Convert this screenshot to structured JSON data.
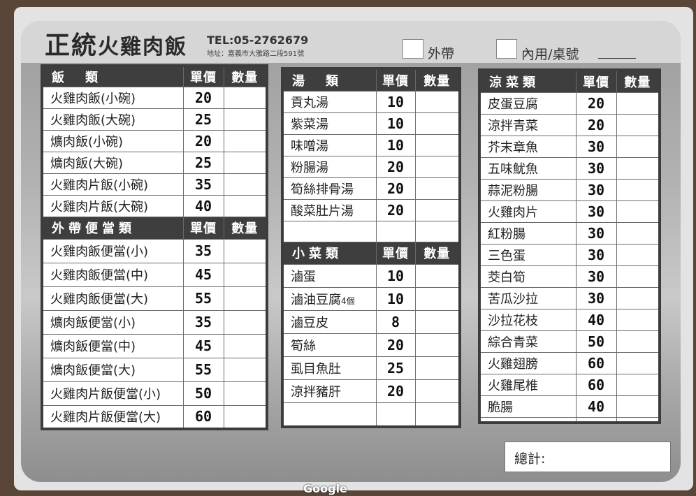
{
  "header": {
    "title_a": "正統",
    "title_b": "火雞肉飯",
    "tel": "TEL:05-2762679",
    "address": "地址：嘉義市大雅路二段591號",
    "takeout_label": "外帶",
    "dinein_label": "內用/桌號"
  },
  "col_price": "單價",
  "col_qty": "數量",
  "sections": {
    "rice": {
      "title": "飯　類",
      "items": [
        {
          "name": "火雞肉飯(小碗)",
          "price": "20"
        },
        {
          "name": "火雞肉飯(大碗)",
          "price": "25"
        },
        {
          "name": "爌肉飯(小碗)",
          "price": "20"
        },
        {
          "name": "爌肉飯(大碗)",
          "price": "25"
        },
        {
          "name": "火雞肉片飯(小碗)",
          "price": "35"
        },
        {
          "name": "火雞肉片飯(大碗)",
          "price": "40"
        }
      ]
    },
    "bento": {
      "title": "外帶便當類",
      "items": [
        {
          "name": "火雞肉飯便當(小)",
          "price": "35"
        },
        {
          "name": "火雞肉飯便當(中)",
          "price": "45"
        },
        {
          "name": "火雞肉飯便當(大)",
          "price": "55"
        },
        {
          "name": "爌肉飯便當(小)",
          "price": "35"
        },
        {
          "name": "爌肉飯便當(中)",
          "price": "45"
        },
        {
          "name": "爌肉飯便當(大)",
          "price": "55"
        },
        {
          "name": "火雞肉片飯便當(小)",
          "price": "50"
        },
        {
          "name": "火雞肉片飯便當(大)",
          "price": "60"
        }
      ]
    },
    "soup": {
      "title": "湯　類",
      "items": [
        {
          "name": "貢丸湯",
          "price": "10"
        },
        {
          "name": "紫菜湯",
          "price": "10"
        },
        {
          "name": "味噌湯",
          "price": "10"
        },
        {
          "name": "粉腸湯",
          "price": "20"
        },
        {
          "name": "筍絲排骨湯",
          "price": "20"
        },
        {
          "name": "酸菜肚片湯",
          "price": "20"
        }
      ]
    },
    "side": {
      "title": "小菜類",
      "items": [
        {
          "name": "滷蛋",
          "price": "10"
        },
        {
          "name": "滷油豆腐",
          "note": "4個",
          "price": "10"
        },
        {
          "name": "滷豆皮",
          "price": "8"
        },
        {
          "name": "筍絲",
          "price": "20"
        },
        {
          "name": "虱目魚肚",
          "price": "25"
        },
        {
          "name": "涼拌豬肝",
          "price": "20"
        }
      ]
    },
    "cold": {
      "title": "涼菜類",
      "items": [
        {
          "name": "皮蛋豆腐",
          "price": "20"
        },
        {
          "name": "涼拌青菜",
          "price": "20"
        },
        {
          "name": "芥末章魚",
          "price": "30"
        },
        {
          "name": "五味魷魚",
          "price": "30"
        },
        {
          "name": "蒜泥粉腸",
          "price": "30"
        },
        {
          "name": "火雞肉片",
          "price": "30"
        },
        {
          "name": "紅粉腸",
          "price": "30"
        },
        {
          "name": "三色蛋",
          "price": "30"
        },
        {
          "name": "茭白筍",
          "price": "30"
        },
        {
          "name": "苦瓜沙拉",
          "price": "30"
        },
        {
          "name": "沙拉花枝",
          "price": "40"
        },
        {
          "name": "綜合青菜",
          "price": "50"
        },
        {
          "name": "火雞翅膀",
          "price": "60"
        },
        {
          "name": "火雞尾椎",
          "price": "60"
        },
        {
          "name": "脆腸",
          "price": "40"
        }
      ]
    }
  },
  "total_label": "總計:",
  "watermark": "Google"
}
